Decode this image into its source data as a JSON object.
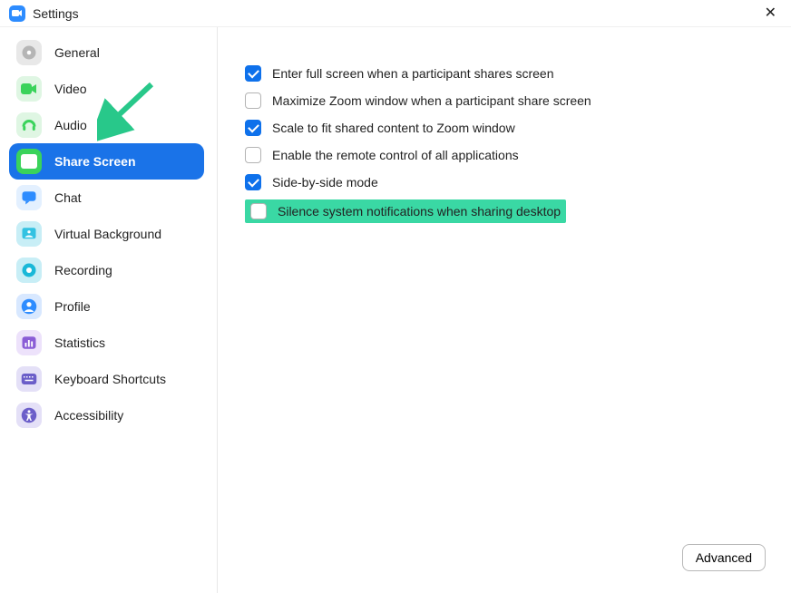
{
  "title": "Settings",
  "sidebar": {
    "items": [
      {
        "label": "General",
        "icon": "general-icon",
        "bg": "#E8E8E8",
        "fg": "#B5B5B5"
      },
      {
        "label": "Video",
        "icon": "video-icon",
        "bg": "#DFF6E3",
        "fg": "#3AD35B"
      },
      {
        "label": "Audio",
        "icon": "audio-icon",
        "bg": "#DFF6E3",
        "fg": "#3AD35B"
      },
      {
        "label": "Share Screen",
        "icon": "share-icon",
        "bg": "#3AD35B",
        "fg": "#FFFFFF",
        "active": true
      },
      {
        "label": "Chat",
        "icon": "chat-icon",
        "bg": "#E3F0FF",
        "fg": "#2D8CFF"
      },
      {
        "label": "Virtual Background",
        "icon": "vbg-icon",
        "bg": "#C8EEF6",
        "fg": "#33C2E2"
      },
      {
        "label": "Recording",
        "icon": "recording-icon",
        "bg": "#C8EEF6",
        "fg": "#1AB8D8"
      },
      {
        "label": "Profile",
        "icon": "profile-icon",
        "bg": "#D8E8FF",
        "fg": "#2D8CFF"
      },
      {
        "label": "Statistics",
        "icon": "stats-icon",
        "bg": "#EDE2FB",
        "fg": "#8A5CD6"
      },
      {
        "label": "Keyboard Shortcuts",
        "icon": "keyboard-icon",
        "bg": "#E4E0F7",
        "fg": "#6B5EC9"
      },
      {
        "label": "Accessibility",
        "icon": "accessibility-icon",
        "bg": "#E4E0F7",
        "fg": "#6B5EC9"
      }
    ]
  },
  "options": [
    {
      "label": "Enter full screen when a participant shares screen",
      "checked": true
    },
    {
      "label": "Maximize Zoom window when a participant share screen",
      "checked": false
    },
    {
      "label": "Scale to fit shared content to Zoom window",
      "checked": true
    },
    {
      "label": "Enable the remote control of all applications",
      "checked": false
    },
    {
      "label": "Side-by-side mode",
      "checked": true
    },
    {
      "label": "Silence system notifications when sharing desktop",
      "checked": false,
      "highlighted": true
    }
  ],
  "advanced_label": "Advanced"
}
